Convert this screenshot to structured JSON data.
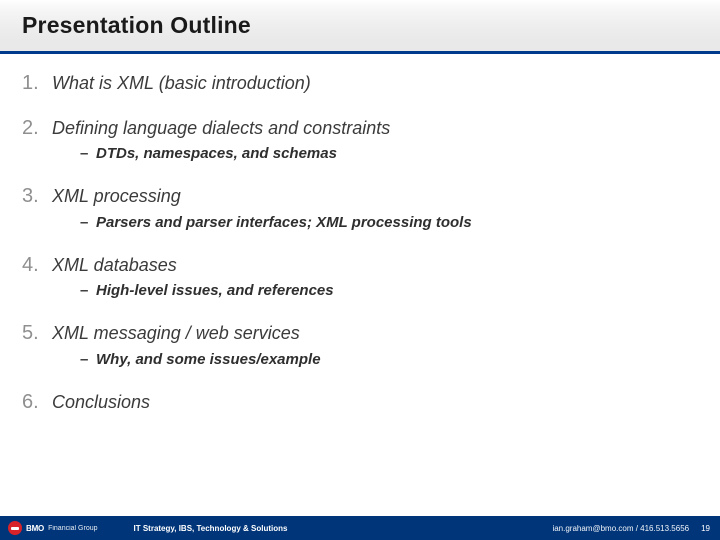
{
  "title": "Presentation Outline",
  "items": [
    {
      "text": "What is XML (basic introduction)",
      "subs": []
    },
    {
      "text": "Defining language dialects and constraints",
      "subs": [
        "DTDs, namespaces, and schemas"
      ]
    },
    {
      "text": "XML processing",
      "subs": [
        "Parsers and parser interfaces; XML processing tools"
      ]
    },
    {
      "text": "XML databases",
      "subs": [
        "High-level issues, and references"
      ]
    },
    {
      "text": "XML messaging / web services",
      "subs": [
        "Why, and some issues/example"
      ]
    },
    {
      "text": "Conclusions",
      "subs": []
    }
  ],
  "footer": {
    "logo_name": "BMO",
    "logo_sub": "Financial Group",
    "department": "IT Strategy, IBS, Technology & Solutions",
    "contact": "ian.graham@bmo.com / 416.513.5656",
    "page_number": "19"
  }
}
